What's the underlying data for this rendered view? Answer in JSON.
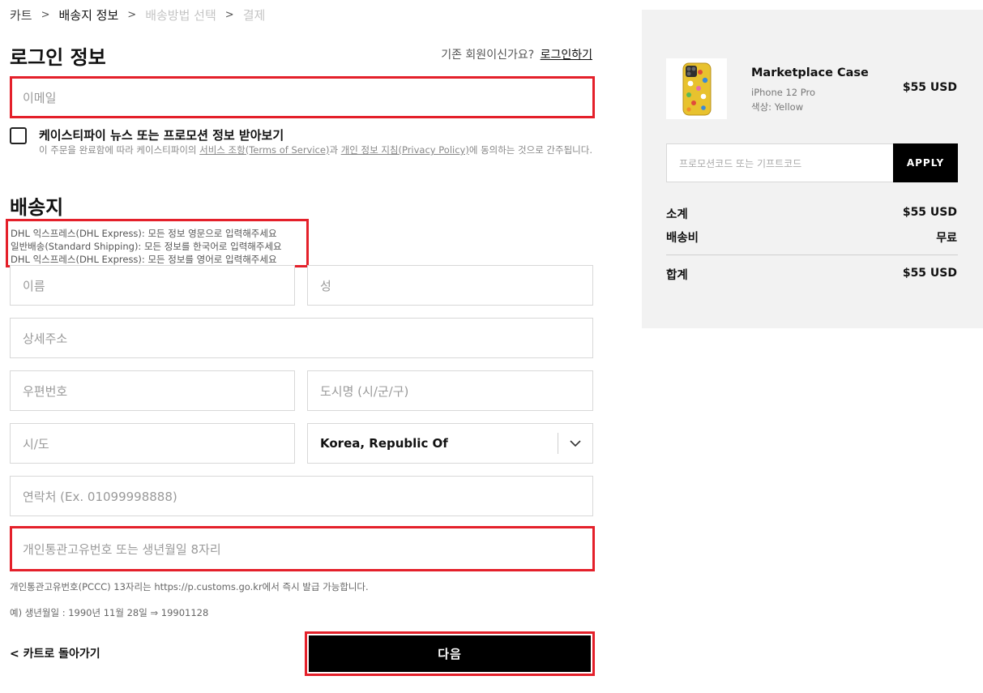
{
  "breadcrumb": {
    "items": [
      "카트",
      "배송지 정보",
      "배송방법 선택",
      "결제"
    ],
    "separator": ">"
  },
  "login": {
    "title": "로그인 정보",
    "existing_member": "기존 회원이신가요?",
    "login_link": "로그인하기",
    "email_placeholder": "이메일",
    "newsletter_label": "케이스티파이 뉴스 또는 프로모션 정보 받아보기",
    "consent": {
      "prefix": "이 주문을 완료함에 따라 케이스티파이의 ",
      "terms": "서비스 조항(Terms of Service)",
      "middle": "과 ",
      "privacy": "개인 정보 지침(Privacy Policy)",
      "suffix": "에 동의하는 것으로 간주됩니다."
    }
  },
  "shipping": {
    "title": "배송지",
    "notices": [
      "DHL 익스프레스(DHL Express): 모든 정보 영문으로 입력해주세요",
      "일반배송(Standard Shipping): 모든 정보를 한국어로 입력해주세요",
      "DHL 익스프레스(DHL Express): 모든 정보를 영어로 입력해주세요"
    ],
    "placeholders": {
      "first_name": "이름",
      "last_name": "성",
      "address": "상세주소",
      "postal_code": "우편번호",
      "city": "도시명 (시/군/구)",
      "state": "시/도",
      "phone": "연락처 (Ex. 01099998888)",
      "customs_id": "개인통관고유번호 또는 생년월일 8자리"
    },
    "country_value": "Korea, Republic Of",
    "customs_help": "개인통관고유번호(PCCC) 13자리는 https://p.customs.go.kr에서 즉시 발급 가능합니다.",
    "birth_example": "예) 생년월일 : 1990년 11월 28일 ⇒ 19901128"
  },
  "footer": {
    "back_label": "< 카트로 돌아가기",
    "next_label": "다음"
  },
  "summary": {
    "product_name": "Marketplace Case",
    "product_model": "iPhone 12 Pro",
    "product_color": "색상: Yellow",
    "product_price": "$55 USD",
    "promo_placeholder": "프로모션코드 또는 기프트코드",
    "apply_label": "APPLY",
    "subtotal_label": "소계",
    "subtotal_value": "$55 USD",
    "shipping_label": "배송비",
    "shipping_value": "무료",
    "total_label": "합계",
    "total_value": "$55 USD"
  },
  "colors": {
    "highlight": "#e4202a",
    "panel": "#f2f2f2",
    "button": "#000000"
  },
  "icons": [
    "chevron-down-icon",
    "phone-case-thumbnail"
  ]
}
